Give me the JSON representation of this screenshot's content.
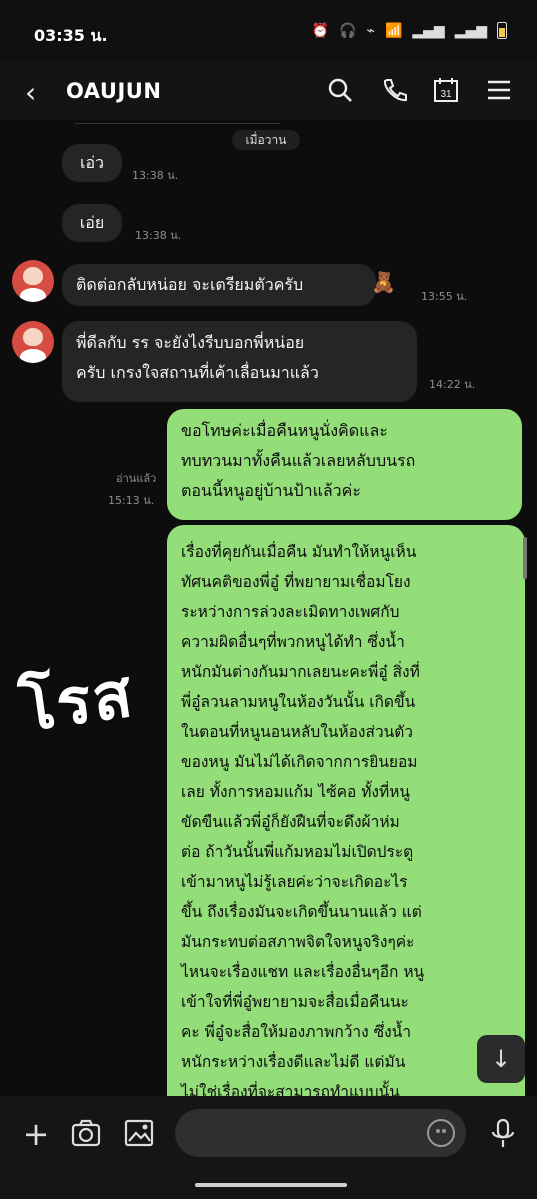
{
  "status": {
    "time": "03:35 น."
  },
  "header": {
    "title": "OAUJUN",
    "back_icon": "back-arrow-icon"
  },
  "chat": {
    "date_divider": "เมื่อวาน",
    "messages": [
      {
        "id": "m1",
        "sender": "other",
        "text": "เอ่ว",
        "time": "13:38 น."
      },
      {
        "id": "m2",
        "sender": "other",
        "text": "เอ่ย",
        "time": "13:38 น."
      },
      {
        "id": "m3",
        "sender": "other",
        "text": "ติดต่อกลับหน่อย จะเตรียมตัวครับ",
        "time": "13:55 น."
      },
      {
        "id": "m4",
        "sender": "other",
        "text": "พี่ดีลกับ รร จะยังไงรีบบอกพี่หน่อย\nครับ เกรงใจสถานที่เค้าเลื่อนมาแล้ว",
        "time": "14:22 น."
      },
      {
        "id": "m5",
        "sender": "me",
        "text": "ขอโทษค่ะเมื่อคืนหนูนั่งคิดและ\nทบทวนมาทั้งคืนแล้วเลยหลับบนรถ\nตอนนี้หนูอยู่บ้านป้าแล้วค่ะ",
        "read_status": "อ่านแล้ว",
        "time": "15:13 น."
      },
      {
        "id": "m6",
        "sender": "me",
        "text": "เรื่องที่คุยกันเมื่อคืน มันทำให้หนูเห็น\nทัศนคติของพี่อู๋ ที่พยายามเชื่อมโยง\nระหว่างการล่วงละเมิดทางเพศกับ\nความผิดอื่นๆที่พวกหนูได้ทำ ซึ่งน้ำ\nหนักมันต่างกันมากเลยนะคะพี่อู๋ สิ่งที่\nพี่อู๋ลวนลามหนูในห้องวันนั้น เกิดขึ้น\nในตอนที่หนูนอนหลับในห้องส่วนตัว\nของหนู มันไม่ได้เกิดจากการยินยอม\nเลย ทั้งการหอมแก้ม ไซ้คอ ทั้งที่หนู\nขัดขืนแล้วพี่อู๋ก็ยังฝืนที่จะดึงผ้าห่ม\nต่อ ถ้าวันนั้นพี่แก้มหอมไม่เปิดประตู\nเข้ามาหนูไม่รู้เลยค่ะว่าจะเกิดอะไร\nขึ้น ถึงเรื่องมันจะเกิดขึ้นนานแล้ว แต่\nมันกระทบต่อสภาพจิตใจหนูจริงๆค่ะ\nไหนจะเรื่องแชท และเรื่องอื่นๆอีก หนู\nเข้าใจที่พี่อู๋พยายามจะสื่อเมื่อคืนนะ\nคะ พี่อู๋จะสื่อให้มองภาพกว้าง ซึ่งน้ำ\nหนักระหว่างเรื่องดีและไม่ดี แต่มัน\nไม่ใช่เรื่องที่จะสามารถทำแบบนั้น\nได้นะคะ สิ่งที่พี่อู๋ทำมันไม่ใช่แค่การ"
      }
    ]
  },
  "overlay": {
    "watermark": "โรส"
  },
  "input": {
    "placeholder": "",
    "icons": [
      "plus-icon",
      "camera-icon",
      "image-icon",
      "emoji-icon",
      "microphone-icon"
    ]
  }
}
